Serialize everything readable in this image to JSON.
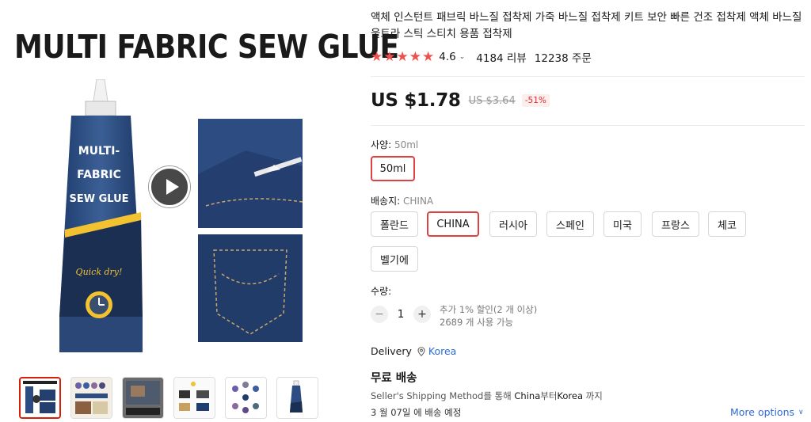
{
  "gallery": {
    "hero_title": "MULTI FABRIC SEW GLUE",
    "tube_label_line1": "MULTI-",
    "tube_label_line2": "FABRIC",
    "tube_label_line3": "SEW GLUE",
    "tube_tagline": "Quick dry!",
    "thumbnails": [
      {
        "name": "thumbnail-1",
        "active": true
      },
      {
        "name": "thumbnail-2",
        "active": false
      },
      {
        "name": "thumbnail-3",
        "active": false
      },
      {
        "name": "thumbnail-4",
        "active": false
      },
      {
        "name": "thumbnail-5",
        "active": false
      },
      {
        "name": "thumbnail-6",
        "active": false
      }
    ]
  },
  "product": {
    "title": "액체 인스턴트 패브릭 바느질 접착제 가죽 바느질 접착제 키트 보안 빠른 건조 접착제 액체 바느질 울트라 스틱 스티치 용품 접착제",
    "rating": "4.6",
    "star_count": 5,
    "reviews": "4184 리뷰",
    "orders": "12238 주문"
  },
  "price": {
    "current": "US $1.78",
    "original": "US $3.64",
    "discount": "-51%"
  },
  "spec": {
    "label": "사양:",
    "value": "50ml",
    "options": [
      "50ml"
    ],
    "selected": "50ml"
  },
  "ships_from": {
    "label": "배송지:",
    "value": "CHINA",
    "options": [
      "폴란드",
      "CHINA",
      "러시아",
      "스페인",
      "미국",
      "프랑스",
      "체코",
      "벨기에"
    ],
    "selected": "CHINA"
  },
  "quantity": {
    "label": "수량:",
    "value": "1",
    "minus": "−",
    "plus": "+",
    "discount_note": "추가 1% 할인(2 개 이상)",
    "available": "2689 개 사용 가능"
  },
  "delivery": {
    "label": "Delivery",
    "location": "Korea",
    "free_shipping": "무료 배송",
    "method_prefix": "Seller's Shipping Method를 통해 ",
    "method_from": "China",
    "method_mid": "부터",
    "method_to": "Korea",
    "method_suffix": " 까지",
    "eta": "3 월 07일 에 배송 예정",
    "more_options": "More options"
  },
  "colors": {
    "accent_red": "#e04040",
    "link_blue": "#2e6bd3",
    "star_red": "#f04f4a"
  }
}
